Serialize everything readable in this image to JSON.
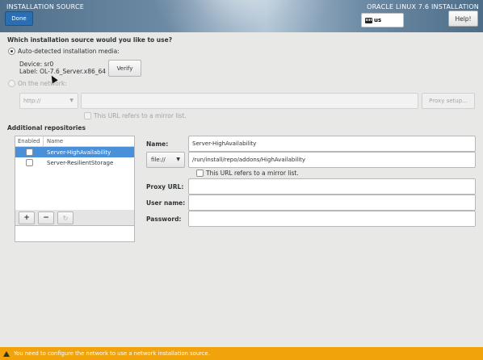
{
  "header": {
    "title": "INSTALLATION SOURCE",
    "done_label": "Done",
    "product": "ORACLE LINUX 7.6 INSTALLATION",
    "keyboard_layout": "us",
    "help_label": "Help!"
  },
  "source": {
    "question": "Which installation source would you like to use?",
    "auto_label": "Auto-detected installation media:",
    "device": "Device: sr0",
    "label": "Label: OL-7.6_Server.x86_64",
    "verify_label": "Verify",
    "network_label": "On the network:",
    "protocol": "http://",
    "url_value": "",
    "proxy_setup_label": "Proxy setup...",
    "mirror_label": "This URL refers to a mirror list."
  },
  "repos": {
    "heading": "Additional repositories",
    "col_enabled": "Enabled",
    "col_name": "Name",
    "items": [
      {
        "name": "Server-HighAvailability",
        "enabled": false,
        "selected": true
      },
      {
        "name": "Server-ResilientStorage",
        "enabled": false,
        "selected": false
      }
    ],
    "add_label": "+",
    "remove_label": "−",
    "reset_label": "↻"
  },
  "detail": {
    "name_label": "Name:",
    "name_value": "Server-HighAvailability",
    "protocol": "file://",
    "url_value": "/run/install/repo/addons/HighAvailability",
    "mirror_label": "This URL refers to a mirror list.",
    "proxy_label": "Proxy URL:",
    "proxy_value": "",
    "username_label": "User name:",
    "username_value": "",
    "password_label": "Password:",
    "password_value": ""
  },
  "status": {
    "warning": "You need to configure the network to use a network installation source."
  },
  "colors": {
    "accent": "#4a90d9",
    "warning_bar": "#f0a30a",
    "done_button": "#2a6fb3"
  }
}
